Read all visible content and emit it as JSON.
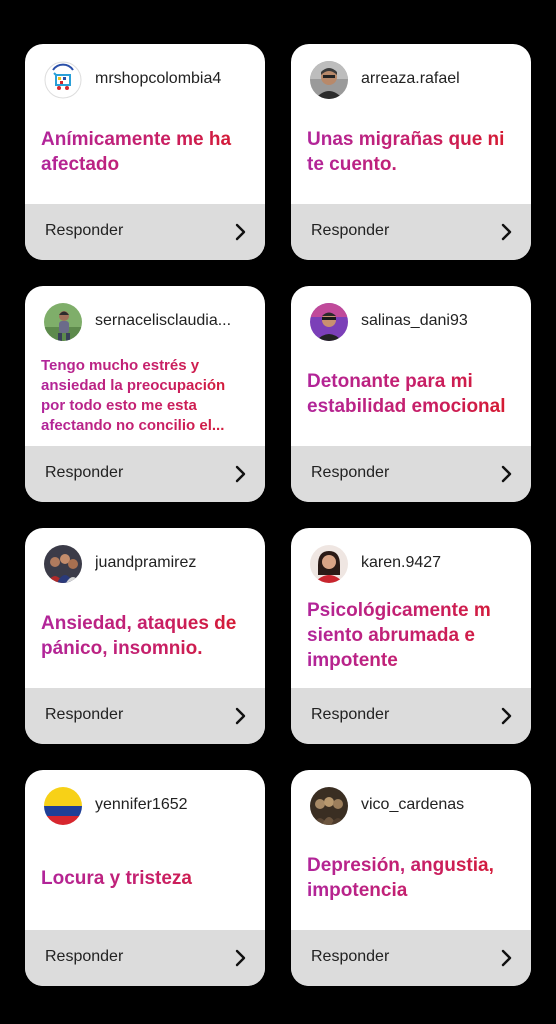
{
  "respond_label": "Responder",
  "cards": [
    {
      "username": "mrshopcolombia4",
      "answer": "Anímicamente me ha afectado",
      "avatar_icon": "shop-logo-icon"
    },
    {
      "username": "arreaza.rafael",
      "answer": "Unas migrañas que ni te cuento.",
      "avatar_icon": "person-avatar-icon"
    },
    {
      "username": "sernacelisclaudia...",
      "answer": "Tengo  mucho estrés y ansiedad la preocupación por todo esto me esta afectando  no concilio el...",
      "avatar_icon": "person-outdoor-avatar-icon"
    },
    {
      "username": "salinas_dani93",
      "answer": "Detonante para mi estabilidad emocional",
      "avatar_icon": "person-purple-avatar-icon"
    },
    {
      "username": "juandpramirez",
      "answer": "Ansiedad, ataques de pánico, insomnio.",
      "avatar_icon": "group-avatar-icon"
    },
    {
      "username": "karen.9427",
      "answer": "Psicológicamente m siento abrumada e impotente",
      "avatar_icon": "person-red-avatar-icon"
    },
    {
      "username": "yennifer1652",
      "answer": "Locura y tristeza",
      "avatar_icon": "colombia-flag-icon"
    },
    {
      "username": "vico_cardenas",
      "answer": "Depresión, angustia, impotencia",
      "avatar_icon": "group-sepia-avatar-icon"
    }
  ],
  "colors": {
    "background": "#000000",
    "card": "#ffffff",
    "respond_bar": "#dcdcdc",
    "answer_gradient_start": "#b1259b",
    "answer_gradient_end": "#d71a2a"
  }
}
